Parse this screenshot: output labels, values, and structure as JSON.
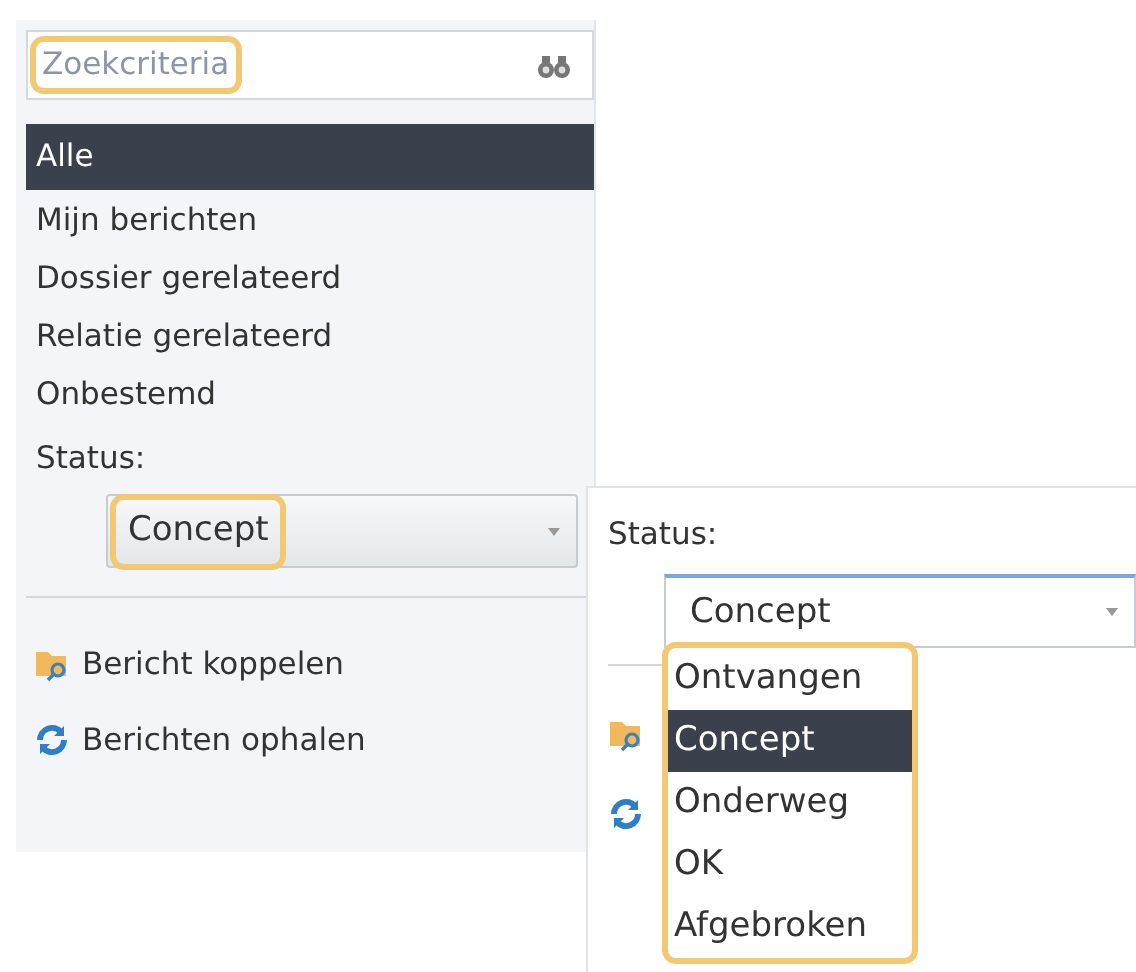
{
  "left_panel": {
    "search": {
      "placeholder": "Zoekcriteria",
      "highlighted": true
    },
    "filters": [
      {
        "label": "Alle",
        "selected": true
      },
      {
        "label": "Mijn berichten",
        "selected": false
      },
      {
        "label": "Dossier gerelateerd",
        "selected": false
      },
      {
        "label": "Relatie gerelateerd",
        "selected": false
      },
      {
        "label": "Onbestemd",
        "selected": false
      }
    ],
    "status_label": "Status:",
    "status_select": {
      "value": "Concept",
      "highlighted": true
    },
    "actions": [
      {
        "kind": "link",
        "label": "Bericht koppelen"
      },
      {
        "kind": "refresh",
        "label": "Berichten ophalen"
      }
    ]
  },
  "right_panel": {
    "status_label": "Status:",
    "status_select": {
      "value": "Concept"
    },
    "dropdown": {
      "highlighted": true,
      "options": [
        {
          "label": "Ontvangen",
          "selected": false
        },
        {
          "label": "Concept",
          "selected": true
        },
        {
          "label": "Onderweg",
          "selected": false
        },
        {
          "label": "OK",
          "selected": false
        },
        {
          "label": "Afgebroken",
          "selected": false
        }
      ]
    },
    "actions": [
      {
        "kind": "link"
      },
      {
        "kind": "refresh"
      }
    ]
  }
}
